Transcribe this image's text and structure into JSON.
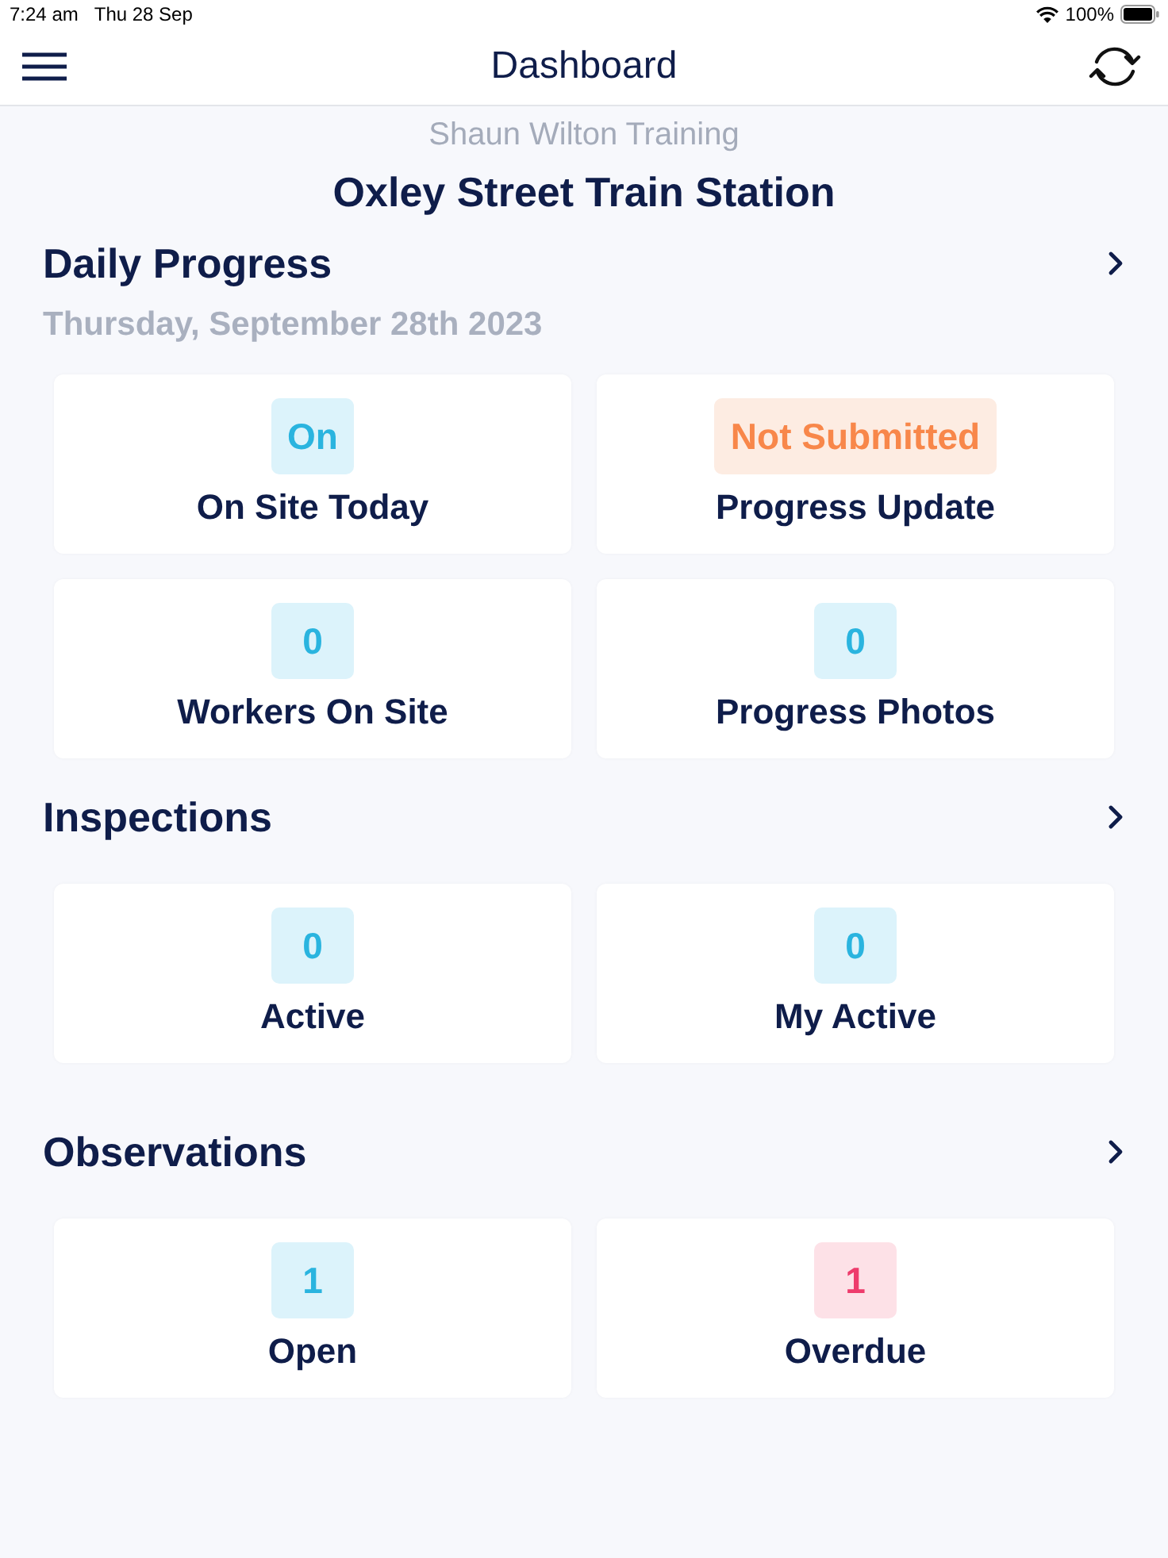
{
  "status_bar": {
    "time": "7:24 am",
    "date": "Thu 28 Sep",
    "battery": "100%"
  },
  "nav_bar": {
    "title": "Dashboard"
  },
  "header": {
    "organization": "Shaun Wilton Training",
    "project": "Oxley Street Train Station"
  },
  "sections": [
    {
      "title": "Daily Progress",
      "subtitle": "Thursday, September 28th 2023",
      "tiles": [
        {
          "value": "On",
          "label": "On Site Today",
          "kind": "info"
        },
        {
          "value": "Not Submitted",
          "label": "Progress Update",
          "kind": "warning"
        },
        {
          "value": "0",
          "label": "Workers On Site",
          "kind": "info"
        },
        {
          "value": "0",
          "label": "Progress Photos",
          "kind": "info"
        }
      ]
    },
    {
      "title": "Inspections",
      "tiles": [
        {
          "value": "0",
          "label": "Active",
          "kind": "info"
        },
        {
          "value": "0",
          "label": "My Active",
          "kind": "info"
        }
      ]
    },
    {
      "title": "Observations",
      "tiles": [
        {
          "value": "1",
          "label": "Open",
          "kind": "info"
        },
        {
          "value": "1",
          "label": "Overdue",
          "kind": "alert"
        }
      ]
    }
  ]
}
